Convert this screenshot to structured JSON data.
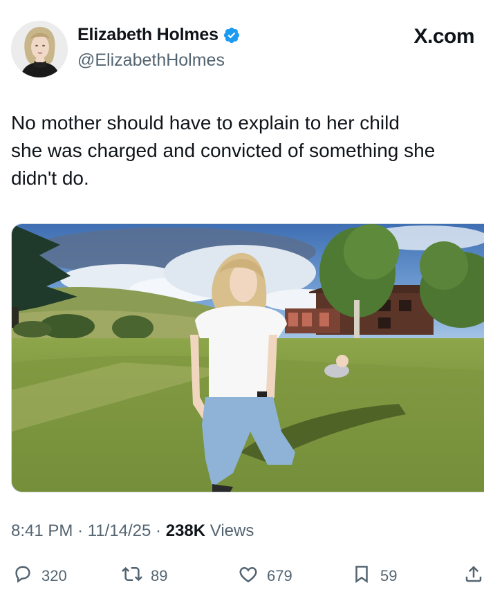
{
  "author": {
    "name": "Elizabeth Holmes",
    "handle": "@ElizabethHolmes",
    "verified": true
  },
  "brand": "X.com",
  "tweet": {
    "lines": [
      "No mother should have to explain to her child",
      "she was charged and convicted of something she",
      "didn't do."
    ]
  },
  "meta": {
    "time": "8:41 PM",
    "separator": "·",
    "date": "11/14/25",
    "views_count": "238K",
    "views_label": "Views"
  },
  "actions": {
    "replies": "320",
    "reposts": "89",
    "likes": "679",
    "bookmarks": "59"
  },
  "colors": {
    "verified_blue": "#1d9bf0",
    "secondary_text": "#536471",
    "primary_text": "#0f1419"
  },
  "icons": [
    "verified-badge-icon",
    "reply-icon",
    "repost-icon",
    "like-icon",
    "bookmark-icon",
    "share-icon"
  ]
}
